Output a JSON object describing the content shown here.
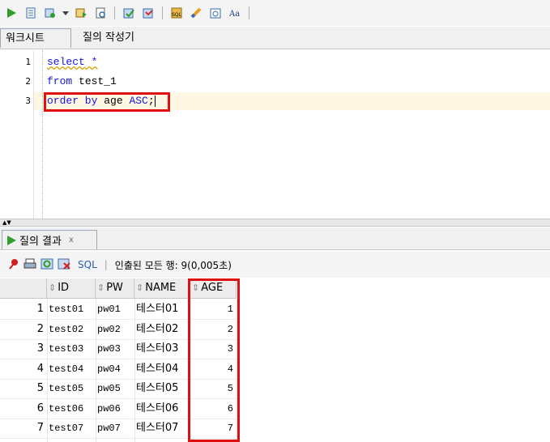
{
  "toolbar": {
    "icons": [
      "run-statement-icon",
      "run-script-icon",
      "autotrace-icon",
      "explain-plan-icon",
      "sql-tuning-icon",
      "commit-icon",
      "rollback-icon",
      "sql-history-icon",
      "clear-icon",
      "unshared-worksheet-icon",
      "format-case-icon"
    ]
  },
  "worksheet_tabs": {
    "active": "워크시트",
    "inactive": "질의 작성기"
  },
  "editor": {
    "line_numbers": [
      "1",
      "2",
      "3"
    ],
    "lines": [
      {
        "kw": "select",
        "rest": " *"
      },
      {
        "kw": "from",
        "rest": " test_1"
      },
      {
        "kw": "order by",
        "rest": " age ",
        "kw2": "ASC",
        "end": ";"
      }
    ]
  },
  "results_tab": {
    "label": "질의 결과",
    "close": "x"
  },
  "results_toolbar": {
    "sql_label": "SQL",
    "separator": "|",
    "status": "인출된 모든 행: 9(0,005초)"
  },
  "grid": {
    "columns": [
      "ID",
      "PW",
      "NAME",
      "AGE"
    ],
    "rows": [
      {
        "num": "1",
        "id": "test01",
        "pw": "pw01",
        "name": "테스터01",
        "age": "1"
      },
      {
        "num": "2",
        "id": "test02",
        "pw": "pw02",
        "name": "테스터02",
        "age": "2"
      },
      {
        "num": "3",
        "id": "test03",
        "pw": "pw03",
        "name": "테스터03",
        "age": "3"
      },
      {
        "num": "4",
        "id": "test04",
        "pw": "pw04",
        "name": "테스터04",
        "age": "4"
      },
      {
        "num": "5",
        "id": "test05",
        "pw": "pw05",
        "name": "테스터05",
        "age": "5"
      },
      {
        "num": "6",
        "id": "test06",
        "pw": "pw06",
        "name": "테스터06",
        "age": "6"
      },
      {
        "num": "7",
        "id": "test07",
        "pw": "pw07",
        "name": "테스터07",
        "age": "7"
      }
    ]
  },
  "colors": {
    "keyword": "#1515d8",
    "highlight_box": "#e01010",
    "current_line": "#fdf7e4",
    "sql_link": "#2a5db0"
  }
}
